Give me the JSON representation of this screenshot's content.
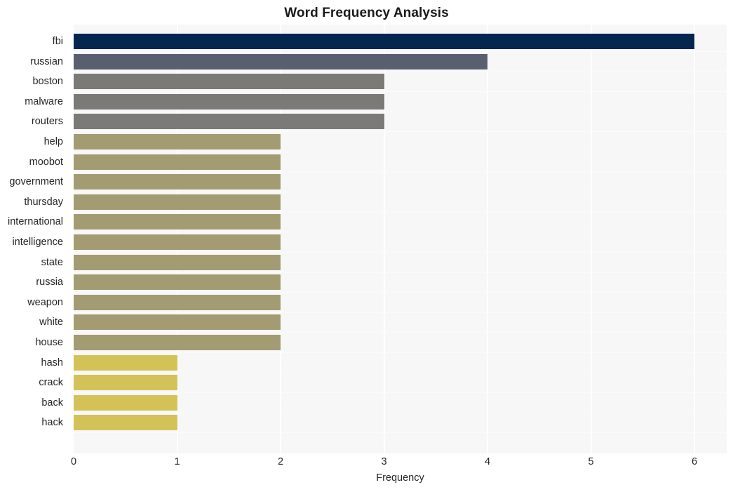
{
  "chart_data": {
    "type": "bar",
    "orientation": "horizontal",
    "title": "Word Frequency Analysis",
    "xlabel": "Frequency",
    "ylabel": "",
    "xlim": [
      0,
      6
    ],
    "xticks": [
      0,
      1,
      2,
      3,
      4,
      5,
      6
    ],
    "xtick_labels": [
      "0",
      "1",
      "2",
      "3",
      "4",
      "5",
      "6"
    ],
    "grid": true,
    "grid_axis": "x",
    "legend": false,
    "categories": [
      "fbi",
      "russian",
      "boston",
      "malware",
      "routers",
      "help",
      "moobot",
      "government",
      "thursday",
      "international",
      "intelligence",
      "state",
      "russia",
      "weapon",
      "white",
      "house",
      "hash",
      "crack",
      "back",
      "hack"
    ],
    "values": [
      6,
      4,
      3,
      3,
      3,
      2,
      2,
      2,
      2,
      2,
      2,
      2,
      2,
      2,
      2,
      2,
      1,
      1,
      1,
      1
    ],
    "bar_colors": [
      "#04264f",
      "#5a5f70",
      "#7b7a77",
      "#7b7a77",
      "#7b7a77",
      "#a39b72",
      "#a39b72",
      "#a39b72",
      "#a39b72",
      "#a39b72",
      "#a39b72",
      "#a39b72",
      "#a39b72",
      "#a39b72",
      "#a39b72",
      "#a39b72",
      "#d3c257",
      "#d3c257",
      "#d3c257",
      "#d3c257"
    ]
  },
  "style": {
    "plot_background": "#f7f7f7",
    "page_background": "#ffffff",
    "gridline_color": "#ffffff",
    "text_color": "#262626",
    "title_color": "#1a1a1a"
  }
}
